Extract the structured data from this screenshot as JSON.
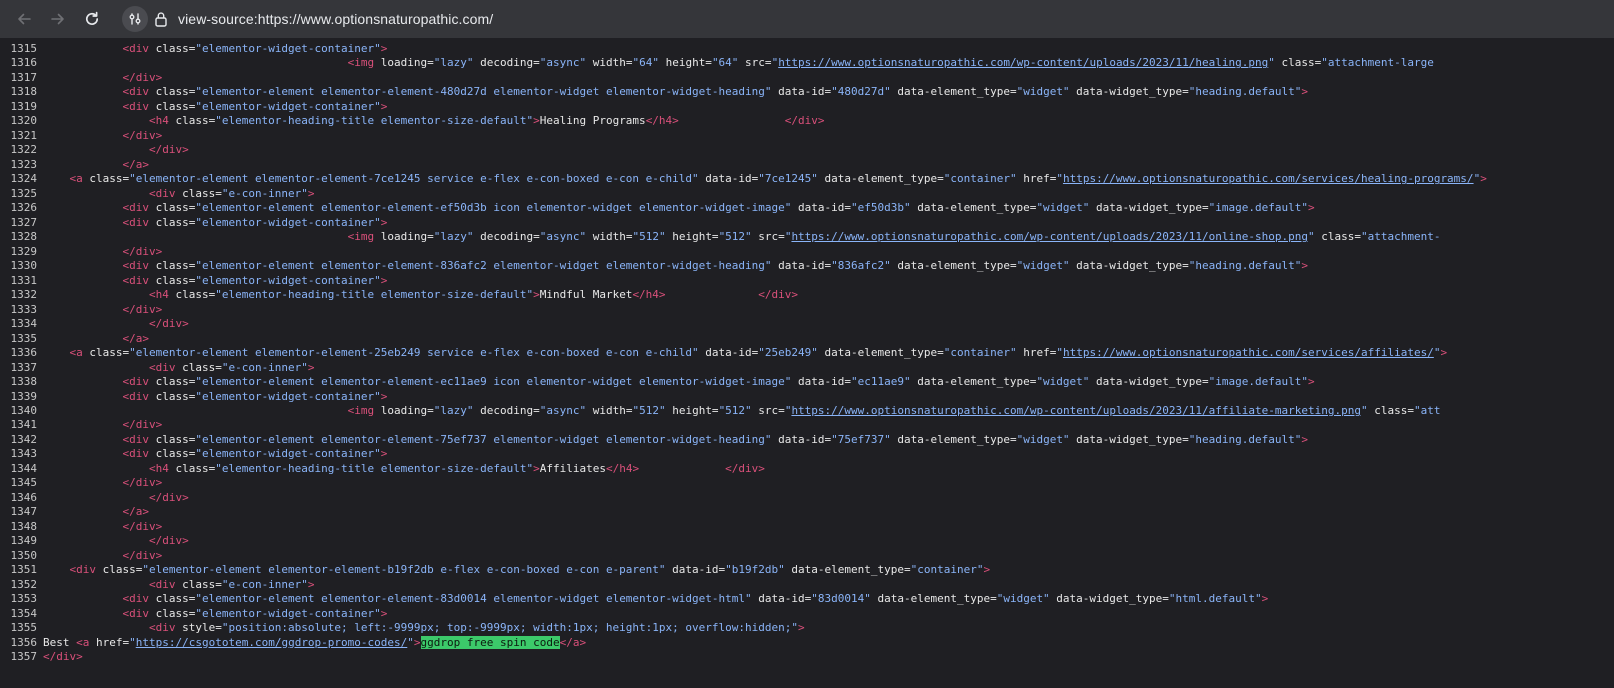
{
  "browser": {
    "url": "view-source:https://www.optionsnaturopathic.com/",
    "back_icon": "arrow-left-icon",
    "forward_icon": "arrow-right-icon",
    "reload_icon": "reload-icon",
    "tune_icon": "site-settings-icon",
    "lock_icon": "lock-icon"
  },
  "colors": {
    "tag": "#d9507a",
    "attr_value": "#8ab4f8",
    "text": "#e8e8e8",
    "highlight": "#3cc96a"
  },
  "source_lines": [
    {
      "n": "1315",
      "ind": "            ",
      "parts": [
        [
          "t",
          "<div"
        ],
        [
          "a",
          " class="
        ],
        [
          "v",
          "\"elementor-widget-container\""
        ],
        [
          "t",
          ">"
        ]
      ]
    },
    {
      "n": "1316",
      "ind": "                                              ",
      "parts": [
        [
          "t",
          "<img"
        ],
        [
          "a",
          " loading="
        ],
        [
          "v",
          "\"lazy\""
        ],
        [
          "a",
          " decoding="
        ],
        [
          "v",
          "\"async\""
        ],
        [
          "a",
          " width="
        ],
        [
          "v",
          "\"64\""
        ],
        [
          "a",
          " height="
        ],
        [
          "v",
          "\"64\""
        ],
        [
          "a",
          " src="
        ],
        [
          "v",
          "\""
        ],
        [
          "l",
          "https://www.optionsnaturopathic.com/wp-content/uploads/2023/11/healing.png"
        ],
        [
          "v",
          "\""
        ],
        [
          "a",
          " class="
        ],
        [
          "v",
          "\"attachment-large"
        ]
      ]
    },
    {
      "n": "1317",
      "ind": "            ",
      "parts": [
        [
          "t",
          "</div>"
        ]
      ]
    },
    {
      "n": "1318",
      "ind": "            ",
      "parts": [
        [
          "t",
          "<div"
        ],
        [
          "a",
          " class="
        ],
        [
          "v",
          "\"elementor-element elementor-element-480d27d elementor-widget elementor-widget-heading\""
        ],
        [
          "a",
          " data-id="
        ],
        [
          "v",
          "\"480d27d\""
        ],
        [
          "a",
          " data-element_type="
        ],
        [
          "v",
          "\"widget\""
        ],
        [
          "a",
          " data-widget_type="
        ],
        [
          "v",
          "\"heading.default\""
        ],
        [
          "t",
          ">"
        ]
      ]
    },
    {
      "n": "1319",
      "ind": "            ",
      "parts": [
        [
          "t",
          "<div"
        ],
        [
          "a",
          " class="
        ],
        [
          "v",
          "\"elementor-widget-container\""
        ],
        [
          "t",
          ">"
        ]
      ]
    },
    {
      "n": "1320",
      "ind": "                ",
      "parts": [
        [
          "t",
          "<h4"
        ],
        [
          "a",
          " class="
        ],
        [
          "v",
          "\"elementor-heading-title elementor-size-default\""
        ],
        [
          "t",
          ">"
        ],
        [
          "x",
          "Healing Programs"
        ],
        [
          "t",
          "</h4>"
        ],
        [
          "x",
          "                "
        ],
        [
          "t",
          "</div>"
        ]
      ]
    },
    {
      "n": "1321",
      "ind": "            ",
      "parts": [
        [
          "t",
          "</div>"
        ]
      ]
    },
    {
      "n": "1322",
      "ind": "                ",
      "parts": [
        [
          "t",
          "</div>"
        ]
      ]
    },
    {
      "n": "1323",
      "ind": "            ",
      "parts": [
        [
          "t",
          "</a>"
        ]
      ]
    },
    {
      "n": "1324",
      "ind": "    ",
      "parts": [
        [
          "t",
          "<a"
        ],
        [
          "a",
          " class="
        ],
        [
          "v",
          "\"elementor-element elementor-element-7ce1245 service e-flex e-con-boxed e-con e-child\""
        ],
        [
          "a",
          " data-id="
        ],
        [
          "v",
          "\"7ce1245\""
        ],
        [
          "a",
          " data-element_type="
        ],
        [
          "v",
          "\"container\""
        ],
        [
          "a",
          " href="
        ],
        [
          "v",
          "\""
        ],
        [
          "l",
          "https://www.optionsnaturopathic.com/services/healing-programs/"
        ],
        [
          "v",
          "\""
        ],
        [
          "t",
          ">"
        ]
      ]
    },
    {
      "n": "1325",
      "ind": "                ",
      "parts": [
        [
          "t",
          "<div"
        ],
        [
          "a",
          " class="
        ],
        [
          "v",
          "\"e-con-inner\""
        ],
        [
          "t",
          ">"
        ]
      ]
    },
    {
      "n": "1326",
      "ind": "            ",
      "parts": [
        [
          "t",
          "<div"
        ],
        [
          "a",
          " class="
        ],
        [
          "v",
          "\"elementor-element elementor-element-ef50d3b icon elementor-widget elementor-widget-image\""
        ],
        [
          "a",
          " data-id="
        ],
        [
          "v",
          "\"ef50d3b\""
        ],
        [
          "a",
          " data-element_type="
        ],
        [
          "v",
          "\"widget\""
        ],
        [
          "a",
          " data-widget_type="
        ],
        [
          "v",
          "\"image.default\""
        ],
        [
          "t",
          ">"
        ]
      ]
    },
    {
      "n": "1327",
      "ind": "            ",
      "parts": [
        [
          "t",
          "<div"
        ],
        [
          "a",
          " class="
        ],
        [
          "v",
          "\"elementor-widget-container\""
        ],
        [
          "t",
          ">"
        ]
      ]
    },
    {
      "n": "1328",
      "ind": "                                              ",
      "parts": [
        [
          "t",
          "<img"
        ],
        [
          "a",
          " loading="
        ],
        [
          "v",
          "\"lazy\""
        ],
        [
          "a",
          " decoding="
        ],
        [
          "v",
          "\"async\""
        ],
        [
          "a",
          " width="
        ],
        [
          "v",
          "\"512\""
        ],
        [
          "a",
          " height="
        ],
        [
          "v",
          "\"512\""
        ],
        [
          "a",
          " src="
        ],
        [
          "v",
          "\""
        ],
        [
          "l",
          "https://www.optionsnaturopathic.com/wp-content/uploads/2023/11/online-shop.png"
        ],
        [
          "v",
          "\""
        ],
        [
          "a",
          " class="
        ],
        [
          "v",
          "\"attachment-"
        ]
      ]
    },
    {
      "n": "1329",
      "ind": "            ",
      "parts": [
        [
          "t",
          "</div>"
        ]
      ]
    },
    {
      "n": "1330",
      "ind": "            ",
      "parts": [
        [
          "t",
          "<div"
        ],
        [
          "a",
          " class="
        ],
        [
          "v",
          "\"elementor-element elementor-element-836afc2 elementor-widget elementor-widget-heading\""
        ],
        [
          "a",
          " data-id="
        ],
        [
          "v",
          "\"836afc2\""
        ],
        [
          "a",
          " data-element_type="
        ],
        [
          "v",
          "\"widget\""
        ],
        [
          "a",
          " data-widget_type="
        ],
        [
          "v",
          "\"heading.default\""
        ],
        [
          "t",
          ">"
        ]
      ]
    },
    {
      "n": "1331",
      "ind": "            ",
      "parts": [
        [
          "t",
          "<div"
        ],
        [
          "a",
          " class="
        ],
        [
          "v",
          "\"elementor-widget-container\""
        ],
        [
          "t",
          ">"
        ]
      ]
    },
    {
      "n": "1332",
      "ind": "                ",
      "parts": [
        [
          "t",
          "<h4"
        ],
        [
          "a",
          " class="
        ],
        [
          "v",
          "\"elementor-heading-title elementor-size-default\""
        ],
        [
          "t",
          ">"
        ],
        [
          "x",
          "Mindful Market"
        ],
        [
          "t",
          "</h4>"
        ],
        [
          "x",
          "              "
        ],
        [
          "t",
          "</div>"
        ]
      ]
    },
    {
      "n": "1333",
      "ind": "            ",
      "parts": [
        [
          "t",
          "</div>"
        ]
      ]
    },
    {
      "n": "1334",
      "ind": "                ",
      "parts": [
        [
          "t",
          "</div>"
        ]
      ]
    },
    {
      "n": "1335",
      "ind": "            ",
      "parts": [
        [
          "t",
          "</a>"
        ]
      ]
    },
    {
      "n": "1336",
      "ind": "    ",
      "parts": [
        [
          "t",
          "<a"
        ],
        [
          "a",
          " class="
        ],
        [
          "v",
          "\"elementor-element elementor-element-25eb249 service e-flex e-con-boxed e-con e-child\""
        ],
        [
          "a",
          " data-id="
        ],
        [
          "v",
          "\"25eb249\""
        ],
        [
          "a",
          " data-element_type="
        ],
        [
          "v",
          "\"container\""
        ],
        [
          "a",
          " href="
        ],
        [
          "v",
          "\""
        ],
        [
          "l",
          "https://www.optionsnaturopathic.com/services/affiliates/"
        ],
        [
          "v",
          "\""
        ],
        [
          "t",
          ">"
        ]
      ]
    },
    {
      "n": "1337",
      "ind": "                ",
      "parts": [
        [
          "t",
          "<div"
        ],
        [
          "a",
          " class="
        ],
        [
          "v",
          "\"e-con-inner\""
        ],
        [
          "t",
          ">"
        ]
      ]
    },
    {
      "n": "1338",
      "ind": "            ",
      "parts": [
        [
          "t",
          "<div"
        ],
        [
          "a",
          " class="
        ],
        [
          "v",
          "\"elementor-element elementor-element-ec11ae9 icon elementor-widget elementor-widget-image\""
        ],
        [
          "a",
          " data-id="
        ],
        [
          "v",
          "\"ec11ae9\""
        ],
        [
          "a",
          " data-element_type="
        ],
        [
          "v",
          "\"widget\""
        ],
        [
          "a",
          " data-widget_type="
        ],
        [
          "v",
          "\"image.default\""
        ],
        [
          "t",
          ">"
        ]
      ]
    },
    {
      "n": "1339",
      "ind": "            ",
      "parts": [
        [
          "t",
          "<div"
        ],
        [
          "a",
          " class="
        ],
        [
          "v",
          "\"elementor-widget-container\""
        ],
        [
          "t",
          ">"
        ]
      ]
    },
    {
      "n": "1340",
      "ind": "                                              ",
      "parts": [
        [
          "t",
          "<img"
        ],
        [
          "a",
          " loading="
        ],
        [
          "v",
          "\"lazy\""
        ],
        [
          "a",
          " decoding="
        ],
        [
          "v",
          "\"async\""
        ],
        [
          "a",
          " width="
        ],
        [
          "v",
          "\"512\""
        ],
        [
          "a",
          " height="
        ],
        [
          "v",
          "\"512\""
        ],
        [
          "a",
          " src="
        ],
        [
          "v",
          "\""
        ],
        [
          "l",
          "https://www.optionsnaturopathic.com/wp-content/uploads/2023/11/affiliate-marketing.png"
        ],
        [
          "v",
          "\""
        ],
        [
          "a",
          " class="
        ],
        [
          "v",
          "\"att"
        ]
      ]
    },
    {
      "n": "1341",
      "ind": "            ",
      "parts": [
        [
          "t",
          "</div>"
        ]
      ]
    },
    {
      "n": "1342",
      "ind": "            ",
      "parts": [
        [
          "t",
          "<div"
        ],
        [
          "a",
          " class="
        ],
        [
          "v",
          "\"elementor-element elementor-element-75ef737 elementor-widget elementor-widget-heading\""
        ],
        [
          "a",
          " data-id="
        ],
        [
          "v",
          "\"75ef737\""
        ],
        [
          "a",
          " data-element_type="
        ],
        [
          "v",
          "\"widget\""
        ],
        [
          "a",
          " data-widget_type="
        ],
        [
          "v",
          "\"heading.default\""
        ],
        [
          "t",
          ">"
        ]
      ]
    },
    {
      "n": "1343",
      "ind": "            ",
      "parts": [
        [
          "t",
          "<div"
        ],
        [
          "a",
          " class="
        ],
        [
          "v",
          "\"elementor-widget-container\""
        ],
        [
          "t",
          ">"
        ]
      ]
    },
    {
      "n": "1344",
      "ind": "                ",
      "parts": [
        [
          "t",
          "<h4"
        ],
        [
          "a",
          " class="
        ],
        [
          "v",
          "\"elementor-heading-title elementor-size-default\""
        ],
        [
          "t",
          ">"
        ],
        [
          "x",
          "Affiliates"
        ],
        [
          "t",
          "</h4>"
        ],
        [
          "x",
          "             "
        ],
        [
          "t",
          "</div>"
        ]
      ]
    },
    {
      "n": "1345",
      "ind": "            ",
      "parts": [
        [
          "t",
          "</div>"
        ]
      ]
    },
    {
      "n": "1346",
      "ind": "                ",
      "parts": [
        [
          "t",
          "</div>"
        ]
      ]
    },
    {
      "n": "1347",
      "ind": "            ",
      "parts": [
        [
          "t",
          "</a>"
        ]
      ]
    },
    {
      "n": "1348",
      "ind": "            ",
      "parts": [
        [
          "t",
          "</div>"
        ]
      ]
    },
    {
      "n": "1349",
      "ind": "                ",
      "parts": [
        [
          "t",
          "</div>"
        ]
      ]
    },
    {
      "n": "1350",
      "ind": "            ",
      "parts": [
        [
          "t",
          "</div>"
        ]
      ]
    },
    {
      "n": "1351",
      "ind": "    ",
      "parts": [
        [
          "t",
          "<div"
        ],
        [
          "a",
          " class="
        ],
        [
          "v",
          "\"elementor-element elementor-element-b19f2db e-flex e-con-boxed e-con e-parent\""
        ],
        [
          "a",
          " data-id="
        ],
        [
          "v",
          "\"b19f2db\""
        ],
        [
          "a",
          " data-element_type="
        ],
        [
          "v",
          "\"container\""
        ],
        [
          "t",
          ">"
        ]
      ]
    },
    {
      "n": "1352",
      "ind": "                ",
      "parts": [
        [
          "t",
          "<div"
        ],
        [
          "a",
          " class="
        ],
        [
          "v",
          "\"e-con-inner\""
        ],
        [
          "t",
          ">"
        ]
      ]
    },
    {
      "n": "1353",
      "ind": "            ",
      "parts": [
        [
          "t",
          "<div"
        ],
        [
          "a",
          " class="
        ],
        [
          "v",
          "\"elementor-element elementor-element-83d0014 elementor-widget elementor-widget-html\""
        ],
        [
          "a",
          " data-id="
        ],
        [
          "v",
          "\"83d0014\""
        ],
        [
          "a",
          " data-element_type="
        ],
        [
          "v",
          "\"widget\""
        ],
        [
          "a",
          " data-widget_type="
        ],
        [
          "v",
          "\"html.default\""
        ],
        [
          "t",
          ">"
        ]
      ]
    },
    {
      "n": "1354",
      "ind": "            ",
      "parts": [
        [
          "t",
          "<div"
        ],
        [
          "a",
          " class="
        ],
        [
          "v",
          "\"elementor-widget-container\""
        ],
        [
          "t",
          ">"
        ]
      ]
    },
    {
      "n": "1355",
      "ind": "                ",
      "parts": [
        [
          "t",
          "<div"
        ],
        [
          "a",
          " style="
        ],
        [
          "v",
          "\"position:absolute; left:-9999px; top:-9999px; width:1px; height:1px; overflow:hidden;\""
        ],
        [
          "t",
          ">"
        ]
      ]
    },
    {
      "n": "1356",
      "ind": "",
      "parts": [
        [
          "x",
          "Best "
        ],
        [
          "t",
          "<a"
        ],
        [
          "a",
          " href="
        ],
        [
          "v",
          "\""
        ],
        [
          "l",
          "https://csgototem.com/ggdrop-promo-codes/"
        ],
        [
          "v",
          "\""
        ],
        [
          "t",
          ">"
        ],
        [
          "h",
          "ggdrop free spin code"
        ],
        [
          "t",
          "</a>"
        ]
      ]
    },
    {
      "n": "1357",
      "ind": "",
      "parts": [
        [
          "t",
          "</div>"
        ]
      ]
    }
  ]
}
